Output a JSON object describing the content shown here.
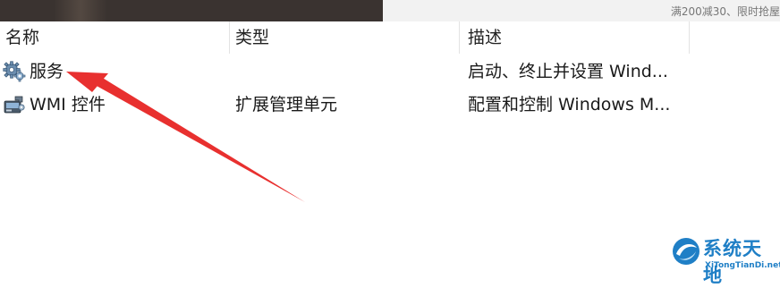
{
  "promo_text": "满200减30、限时抢屋",
  "columns": {
    "name": "名称",
    "type": "类型",
    "description": "描述"
  },
  "rows": [
    {
      "name": "服务",
      "type": "",
      "description": "启动、终止并设置 Wind...",
      "icon": "gear-icon"
    },
    {
      "name": "WMI 控件",
      "type": "扩展管理单元",
      "description": "配置和控制 Windows M...",
      "icon": "wmi-control-icon"
    }
  ],
  "annotation": {
    "icon": "red-arrow",
    "color": "#e8302f"
  },
  "watermark": {
    "title": "系统天地",
    "subtitle": "XiTongTianDi.net",
    "color": "#1f7fc6"
  }
}
